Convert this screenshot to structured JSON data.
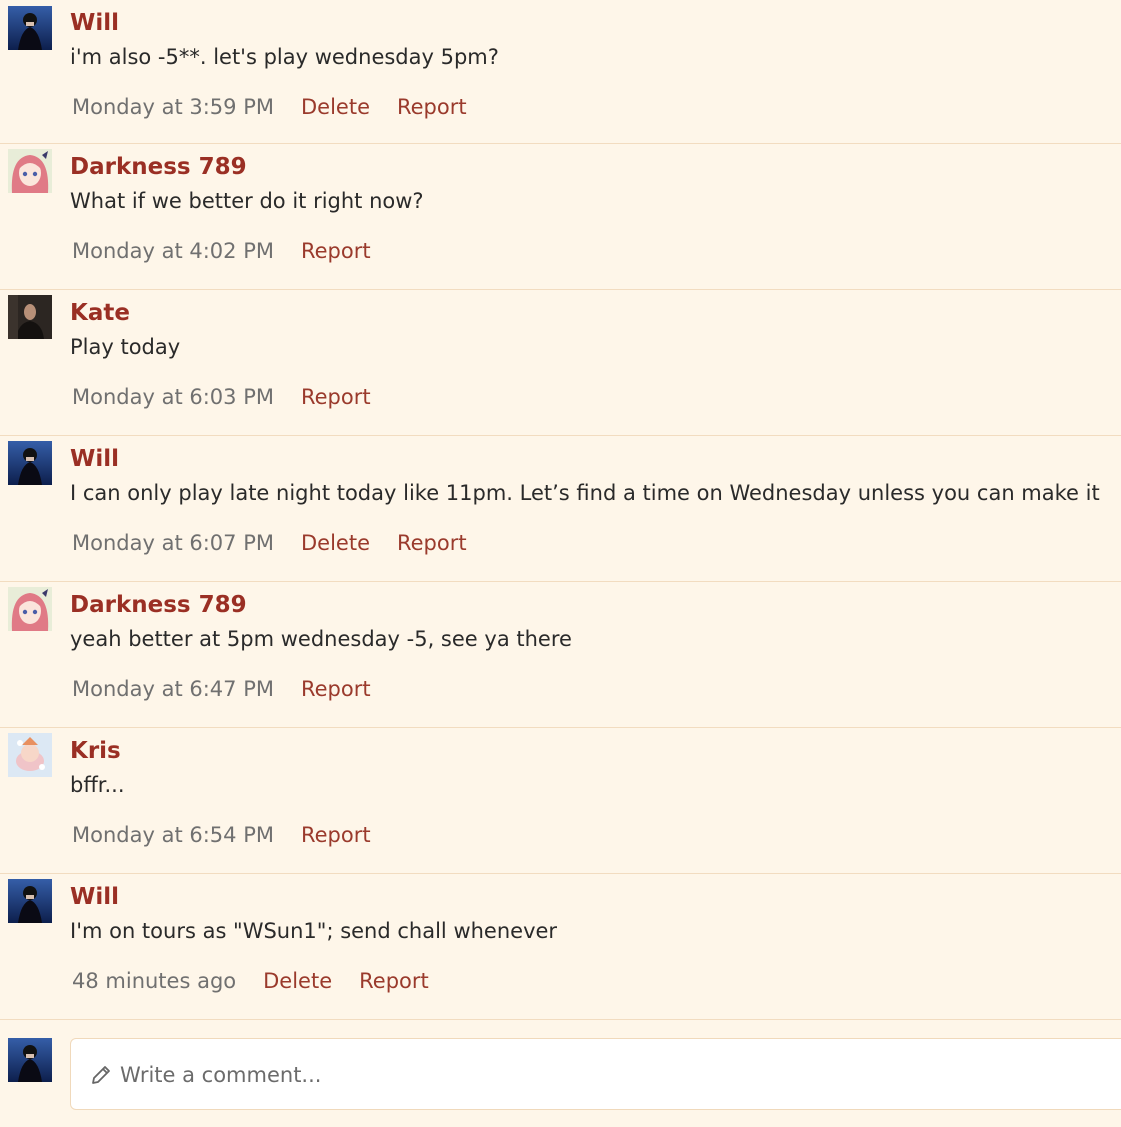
{
  "comments": [
    {
      "author": "Will",
      "avatar": "will-avatar",
      "text": "i'm also -5**. let's play wednesday 5pm?",
      "time": "Monday at 3:59 PM",
      "actions": [
        "Delete",
        "Report"
      ]
    },
    {
      "author": "Darkness 789",
      "avatar": "darkness-avatar",
      "text": "What if we better do it right now?",
      "time": "Monday at 4:02 PM",
      "actions": [
        "Report"
      ]
    },
    {
      "author": "Kate",
      "avatar": "kate-avatar",
      "text": "Play today",
      "time": "Monday at 6:03 PM",
      "actions": [
        "Report"
      ]
    },
    {
      "author": "Will",
      "avatar": "will-avatar",
      "text": "I can only play late night today like 11pm. Let’s find a time on Wednesday unless you can make it",
      "time": "Monday at 6:07 PM",
      "actions": [
        "Delete",
        "Report"
      ]
    },
    {
      "author": "Darkness 789",
      "avatar": "darkness-avatar",
      "text": "yeah better at 5pm wednesday -5, see ya there",
      "time": "Monday at 6:47 PM",
      "actions": [
        "Report"
      ]
    },
    {
      "author": "Kris",
      "avatar": "kris-avatar",
      "text": "bffr...",
      "time": "Monday at 6:54 PM",
      "actions": [
        "Report"
      ]
    },
    {
      "author": "Will",
      "avatar": "will-avatar",
      "text": "I'm on tours as \"WSun1\"; send chall whenever",
      "time": "48 minutes ago",
      "actions": [
        "Delete",
        "Report"
      ]
    }
  ],
  "composer": {
    "placeholder": "Write a comment...",
    "icon": "pencil-icon"
  },
  "colors": {
    "background": "#fef6e9",
    "author": "#9a2f24",
    "action": "#9a3a2c",
    "timestamp": "#707070",
    "divider": "#f2dcc0"
  }
}
